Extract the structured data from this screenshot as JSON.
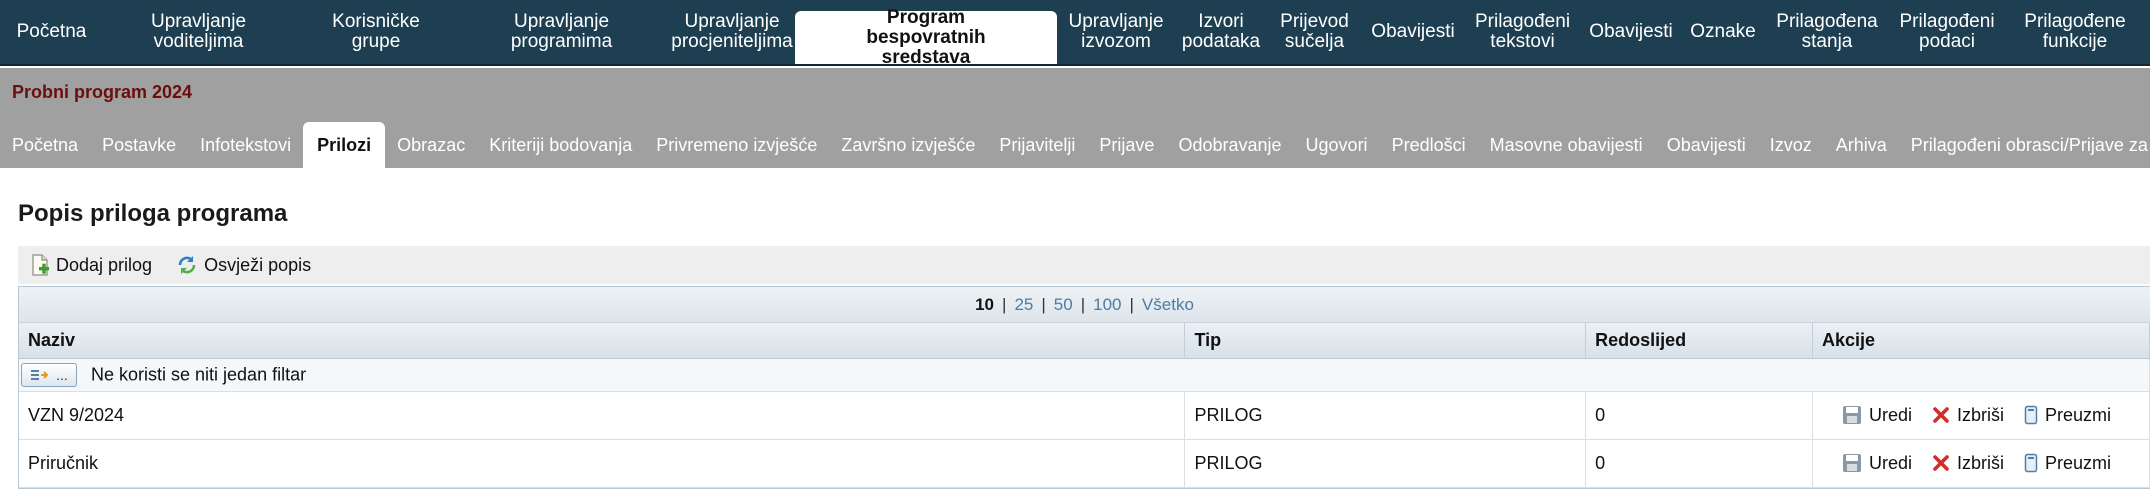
{
  "top_nav": [
    {
      "label": "Početna"
    },
    {
      "label": "Upravljanje voditeljima"
    },
    {
      "label": "Korisničke grupe"
    },
    {
      "label": "Upravljanje programima"
    },
    {
      "label": "Upravljanje\nprocjeniteljima"
    },
    {
      "label": "Program bespovratnih\nsredstava",
      "active": true
    },
    {
      "label": "Upravljanje\nizvozom"
    },
    {
      "label": "Izvori\npodataka"
    },
    {
      "label": "Prijevod\nsučelja"
    },
    {
      "label": "Obavijesti"
    },
    {
      "label": "Prilagođeni\ntekstovi"
    },
    {
      "label": "Obavijesti"
    },
    {
      "label": "Oznake"
    },
    {
      "label": "Prilagođena\nstanja"
    },
    {
      "label": "Prilagođeni\npodaci"
    },
    {
      "label": "Prilagođene\nfunkcije"
    }
  ],
  "program": {
    "title": "Probni program 2024"
  },
  "sub_nav": [
    {
      "label": "Početna"
    },
    {
      "label": "Postavke"
    },
    {
      "label": "Infotekstovi"
    },
    {
      "label": "Prilozi",
      "active": true
    },
    {
      "label": "Obrazac"
    },
    {
      "label": "Kriteriji bodovanja"
    },
    {
      "label": "Privremeno izvješće"
    },
    {
      "label": "Završno izvješće"
    },
    {
      "label": "Prijavitelji"
    },
    {
      "label": "Prijave"
    },
    {
      "label": "Odobravanje"
    },
    {
      "label": "Ugovori"
    },
    {
      "label": "Predlošci"
    },
    {
      "label": "Masovne obavijesti"
    },
    {
      "label": "Obavijesti"
    },
    {
      "label": "Izvoz"
    },
    {
      "label": "Arhiva"
    },
    {
      "label": "Prilagođeni obrasci/Prijave za izmjenu"
    }
  ],
  "page": {
    "title": "Popis priloga programa"
  },
  "toolbar": {
    "add_label": "Dodaj prilog",
    "refresh_label": "Osvježi popis"
  },
  "pager": {
    "sizes": [
      "10",
      "25",
      "50",
      "100",
      "Všetko"
    ],
    "current": "10"
  },
  "table": {
    "columns": [
      "Naziv",
      "Tip",
      "Redoslijed",
      "Akcije"
    ],
    "filter_button": "...",
    "filter_text": "Ne koristi se niti jedan filtar",
    "rows": [
      {
        "naziv": "VZN 9/2024",
        "tip": "PRILOG",
        "redoslijed": "0"
      },
      {
        "naziv": "Priručnik",
        "tip": "PRILOG",
        "redoslijed": "0"
      }
    ],
    "actions": {
      "edit": "Uredi",
      "delete": "Izbriši",
      "download": "Preuzmi"
    }
  },
  "colors": {
    "top_nav_bg": "#1e3f52",
    "program_bar_bg": "#a0a0a0",
    "program_title": "#6b0e0e",
    "pager_link": "#4b7ca5"
  }
}
